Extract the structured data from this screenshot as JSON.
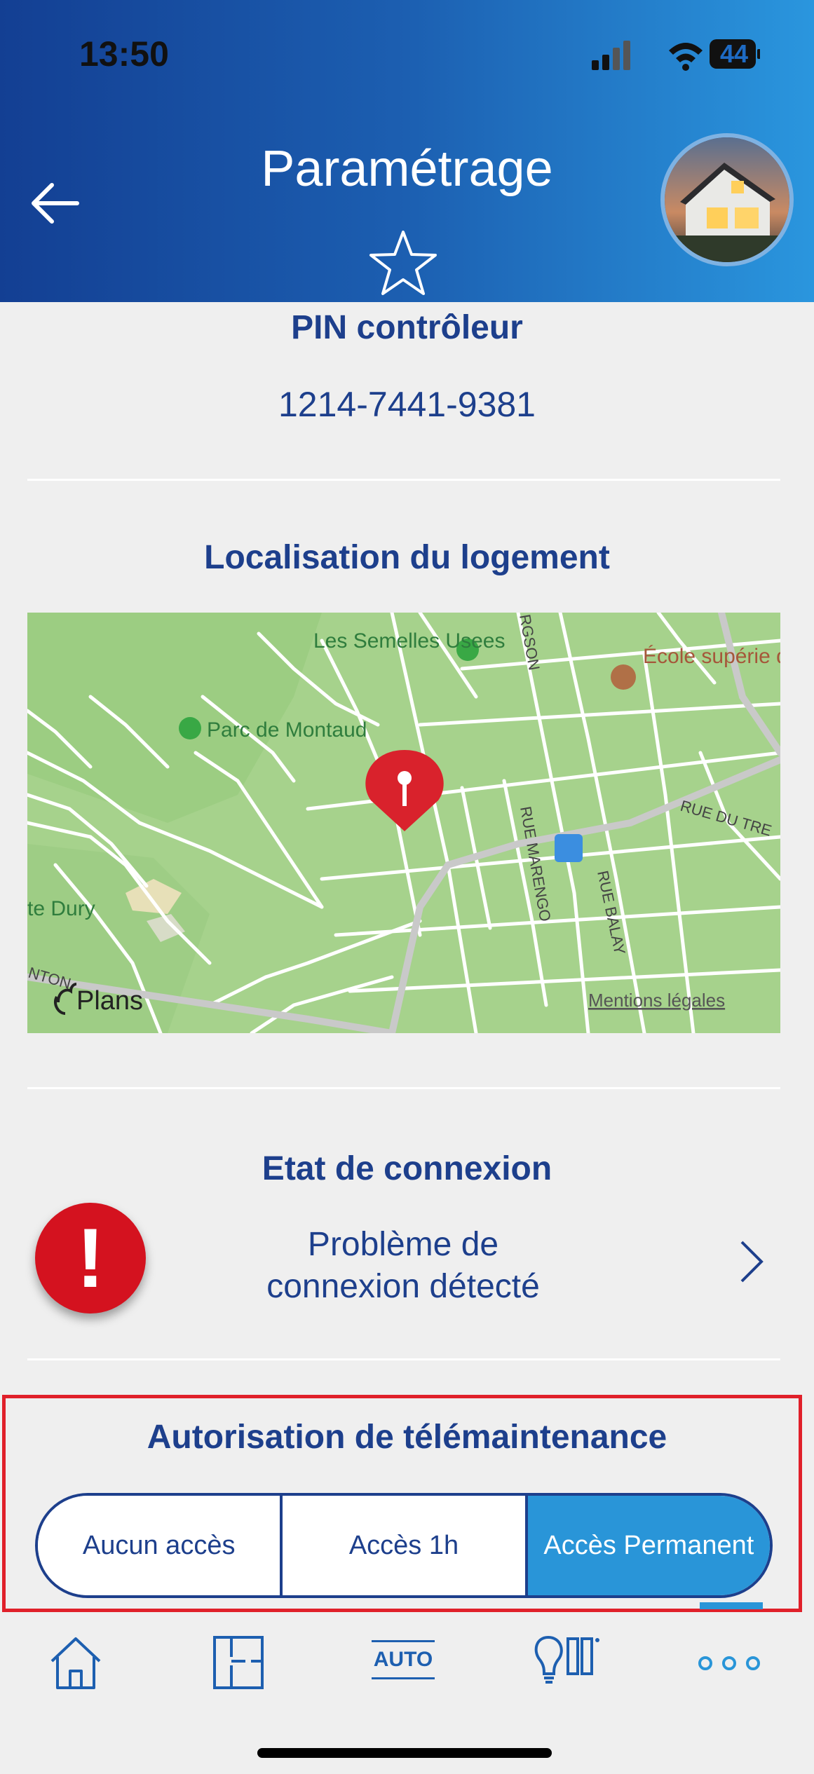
{
  "status_bar": {
    "time": "13:50",
    "battery": "44"
  },
  "header": {
    "title": "Paramétrage"
  },
  "pin": {
    "title": "PIN contrôleur",
    "value": "1214-7441-9381"
  },
  "location": {
    "title": "Localisation du logement",
    "map_labels": {
      "semelles": "Les Semelles Usees",
      "parc": "Parc de Montaud",
      "ecole": "École supérie d'Art et Desig de Saint-Étie",
      "dury": "te Dury",
      "marengo": "RUE MARENGO",
      "balay": "RUE BALAY",
      "rue_du_tre": "RUE DU TRE",
      "rgson": "RGSON",
      "nton": "NTON",
      "brand": "Plans",
      "legal": "Mentions légales"
    }
  },
  "connection": {
    "title": "Etat de connexion",
    "status_line1": "Problème de",
    "status_line2": "connexion détecté",
    "alert_glyph": "!"
  },
  "remote_maintenance": {
    "title": "Autorisation de télémaintenance",
    "options": [
      {
        "label": "Aucun accès",
        "selected": false
      },
      {
        "label": "Accès 1h",
        "selected": false
      },
      {
        "label": "Accès Permanent",
        "selected": true
      }
    ]
  },
  "tabbar": {
    "items": [
      {
        "icon": "home-icon"
      },
      {
        "icon": "floorplan-icon"
      },
      {
        "icon": "auto-icon",
        "label": "AUTO"
      },
      {
        "icon": "lighting-shutters-icon"
      },
      {
        "icon": "more-icon"
      }
    ]
  },
  "colors": {
    "primary": "#1d3f8c",
    "accent": "#2995d8",
    "alert": "#d4121f",
    "highlight": "#e0202a"
  }
}
